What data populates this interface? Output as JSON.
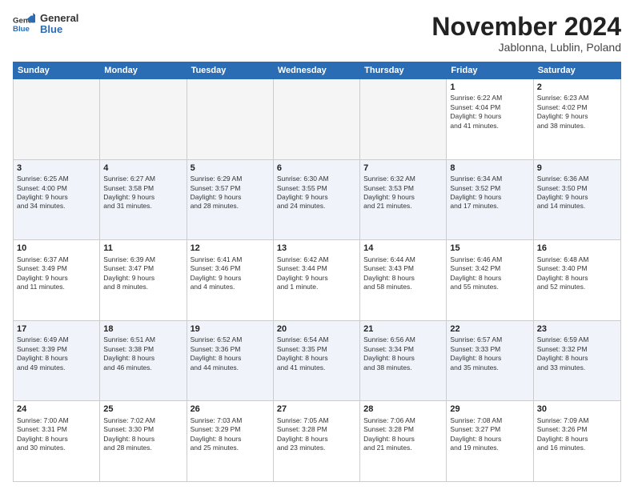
{
  "logo": {
    "general": "General",
    "blue": "Blue"
  },
  "title": "November 2024",
  "subtitle": "Jablonna, Lublin, Poland",
  "days": [
    "Sunday",
    "Monday",
    "Tuesday",
    "Wednesday",
    "Thursday",
    "Friday",
    "Saturday"
  ],
  "weeks": [
    [
      {
        "day": "",
        "info": "",
        "empty": true
      },
      {
        "day": "",
        "info": "",
        "empty": true
      },
      {
        "day": "",
        "info": "",
        "empty": true
      },
      {
        "day": "",
        "info": "",
        "empty": true
      },
      {
        "day": "",
        "info": "",
        "empty": true
      },
      {
        "day": "1",
        "info": "Sunrise: 6:22 AM\nSunset: 4:04 PM\nDaylight: 9 hours\nand 41 minutes."
      },
      {
        "day": "2",
        "info": "Sunrise: 6:23 AM\nSunset: 4:02 PM\nDaylight: 9 hours\nand 38 minutes."
      }
    ],
    [
      {
        "day": "3",
        "info": "Sunrise: 6:25 AM\nSunset: 4:00 PM\nDaylight: 9 hours\nand 34 minutes."
      },
      {
        "day": "4",
        "info": "Sunrise: 6:27 AM\nSunset: 3:58 PM\nDaylight: 9 hours\nand 31 minutes."
      },
      {
        "day": "5",
        "info": "Sunrise: 6:29 AM\nSunset: 3:57 PM\nDaylight: 9 hours\nand 28 minutes."
      },
      {
        "day": "6",
        "info": "Sunrise: 6:30 AM\nSunset: 3:55 PM\nDaylight: 9 hours\nand 24 minutes."
      },
      {
        "day": "7",
        "info": "Sunrise: 6:32 AM\nSunset: 3:53 PM\nDaylight: 9 hours\nand 21 minutes."
      },
      {
        "day": "8",
        "info": "Sunrise: 6:34 AM\nSunset: 3:52 PM\nDaylight: 9 hours\nand 17 minutes."
      },
      {
        "day": "9",
        "info": "Sunrise: 6:36 AM\nSunset: 3:50 PM\nDaylight: 9 hours\nand 14 minutes."
      }
    ],
    [
      {
        "day": "10",
        "info": "Sunrise: 6:37 AM\nSunset: 3:49 PM\nDaylight: 9 hours\nand 11 minutes."
      },
      {
        "day": "11",
        "info": "Sunrise: 6:39 AM\nSunset: 3:47 PM\nDaylight: 9 hours\nand 8 minutes."
      },
      {
        "day": "12",
        "info": "Sunrise: 6:41 AM\nSunset: 3:46 PM\nDaylight: 9 hours\nand 4 minutes."
      },
      {
        "day": "13",
        "info": "Sunrise: 6:42 AM\nSunset: 3:44 PM\nDaylight: 9 hours\nand 1 minute."
      },
      {
        "day": "14",
        "info": "Sunrise: 6:44 AM\nSunset: 3:43 PM\nDaylight: 8 hours\nand 58 minutes."
      },
      {
        "day": "15",
        "info": "Sunrise: 6:46 AM\nSunset: 3:42 PM\nDaylight: 8 hours\nand 55 minutes."
      },
      {
        "day": "16",
        "info": "Sunrise: 6:48 AM\nSunset: 3:40 PM\nDaylight: 8 hours\nand 52 minutes."
      }
    ],
    [
      {
        "day": "17",
        "info": "Sunrise: 6:49 AM\nSunset: 3:39 PM\nDaylight: 8 hours\nand 49 minutes."
      },
      {
        "day": "18",
        "info": "Sunrise: 6:51 AM\nSunset: 3:38 PM\nDaylight: 8 hours\nand 46 minutes."
      },
      {
        "day": "19",
        "info": "Sunrise: 6:52 AM\nSunset: 3:36 PM\nDaylight: 8 hours\nand 44 minutes."
      },
      {
        "day": "20",
        "info": "Sunrise: 6:54 AM\nSunset: 3:35 PM\nDaylight: 8 hours\nand 41 minutes."
      },
      {
        "day": "21",
        "info": "Sunrise: 6:56 AM\nSunset: 3:34 PM\nDaylight: 8 hours\nand 38 minutes."
      },
      {
        "day": "22",
        "info": "Sunrise: 6:57 AM\nSunset: 3:33 PM\nDaylight: 8 hours\nand 35 minutes."
      },
      {
        "day": "23",
        "info": "Sunrise: 6:59 AM\nSunset: 3:32 PM\nDaylight: 8 hours\nand 33 minutes."
      }
    ],
    [
      {
        "day": "24",
        "info": "Sunrise: 7:00 AM\nSunset: 3:31 PM\nDaylight: 8 hours\nand 30 minutes."
      },
      {
        "day": "25",
        "info": "Sunrise: 7:02 AM\nSunset: 3:30 PM\nDaylight: 8 hours\nand 28 minutes."
      },
      {
        "day": "26",
        "info": "Sunrise: 7:03 AM\nSunset: 3:29 PM\nDaylight: 8 hours\nand 25 minutes."
      },
      {
        "day": "27",
        "info": "Sunrise: 7:05 AM\nSunset: 3:28 PM\nDaylight: 8 hours\nand 23 minutes."
      },
      {
        "day": "28",
        "info": "Sunrise: 7:06 AM\nSunset: 3:28 PM\nDaylight: 8 hours\nand 21 minutes."
      },
      {
        "day": "29",
        "info": "Sunrise: 7:08 AM\nSunset: 3:27 PM\nDaylight: 8 hours\nand 19 minutes."
      },
      {
        "day": "30",
        "info": "Sunrise: 7:09 AM\nSunset: 3:26 PM\nDaylight: 8 hours\nand 16 minutes."
      }
    ]
  ]
}
